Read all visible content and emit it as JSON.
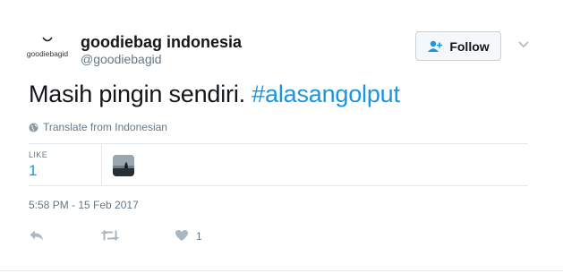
{
  "user": {
    "display_name": "goodiebag indonesia",
    "handle": "@goodiebagid",
    "avatar_text": "goodiebagid"
  },
  "follow_button": {
    "label": "Follow"
  },
  "tweet": {
    "text": "Masih pingin sendiri. ",
    "hashtag": "#alasangolput"
  },
  "translate": {
    "label": "Translate from Indonesian"
  },
  "stats": {
    "likes_label": "LIKE",
    "likes_value": "1"
  },
  "timestamp": "5:58 PM - 15 Feb 2017",
  "actions": {
    "reply_icon": "reply-icon",
    "retweet_icon": "retweet-icon",
    "like_icon": "heart-icon",
    "like_count": "1"
  },
  "colors": {
    "accent": "#1b95e0",
    "muted": "#657786",
    "divider": "#e1e8ed"
  }
}
